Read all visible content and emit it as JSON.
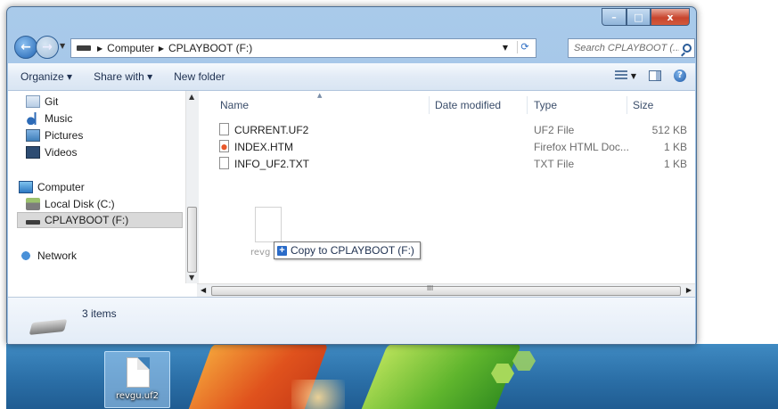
{
  "window": {
    "controls": {
      "minimize": "–",
      "maximize": "□",
      "close": "x"
    }
  },
  "address": {
    "crumbs": [
      "Computer",
      "CPLAYBOOT (F:)"
    ],
    "search_placeholder": "Search CPLAYBOOT (..."
  },
  "toolbar": {
    "organize": "Organize ▾",
    "share": "Share with ▾",
    "new_folder": "New folder"
  },
  "nav": {
    "items": [
      {
        "label": "Git",
        "icon": "git-folder-icon"
      },
      {
        "label": "Music",
        "icon": "music-icon"
      },
      {
        "label": "Pictures",
        "icon": "pictures-icon"
      },
      {
        "label": "Videos",
        "icon": "videos-icon"
      },
      {
        "label": "Computer",
        "icon": "computer-icon"
      },
      {
        "label": "Local Disk (C:)",
        "icon": "local-disk-icon"
      },
      {
        "label": "CPLAYBOOT (F:)",
        "icon": "drive-icon"
      },
      {
        "label": "Network",
        "icon": "network-icon"
      }
    ]
  },
  "files": {
    "columns": [
      "Name",
      "Date modified",
      "Type",
      "Size"
    ],
    "rows": [
      {
        "name": "CURRENT.UF2",
        "date": "",
        "type": "UF2 File",
        "size": "512 KB"
      },
      {
        "name": "INDEX.HTM",
        "date": "",
        "type": "Firefox HTML Doc...",
        "size": "1 KB"
      },
      {
        "name": "INFO_UF2.TXT",
        "date": "",
        "type": "TXT File",
        "size": "1 KB"
      }
    ]
  },
  "drag": {
    "ghost_label": "revg",
    "tooltip": "Copy to CPLAYBOOT (F:)",
    "tooltip_icon": "+"
  },
  "status": {
    "items": "3 items"
  },
  "desktop": {
    "file_label": "revgu.uf2"
  }
}
